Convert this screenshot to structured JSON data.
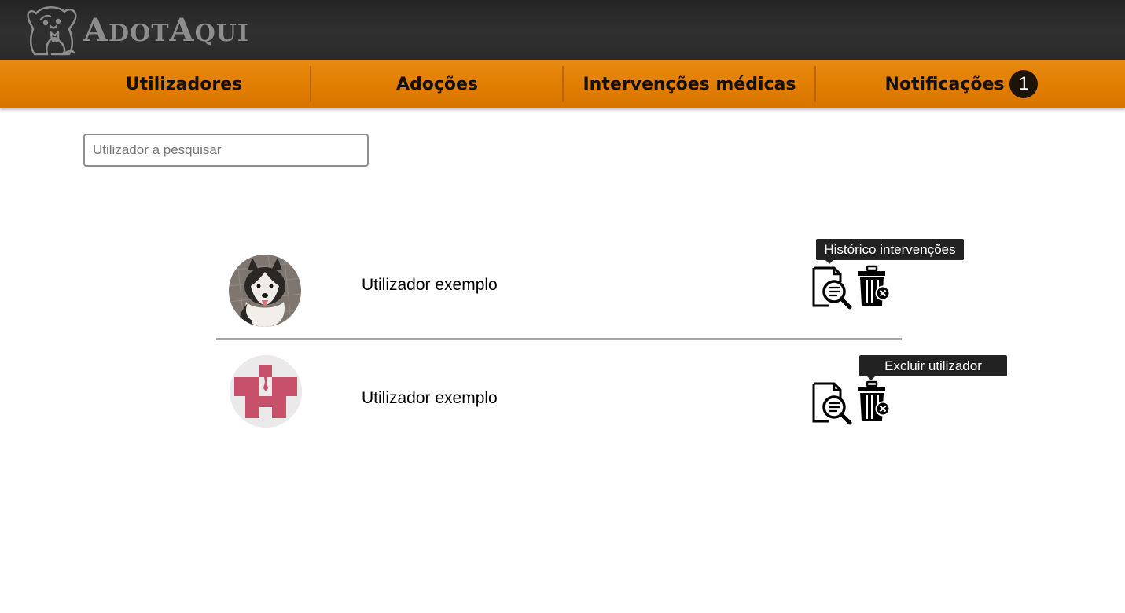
{
  "brand": {
    "name_first": "A",
    "name_first_rest": "DOT",
    "name_second": "A",
    "name_second_rest": "QUI"
  },
  "nav": {
    "items": [
      {
        "label": "Utilizadores"
      },
      {
        "label": "Adoções"
      },
      {
        "label": "Intervenções médicas"
      },
      {
        "label": "Notificações"
      }
    ],
    "notification_count": "1"
  },
  "search": {
    "placeholder": "Utilizador a pesquisar",
    "value": ""
  },
  "users": [
    {
      "name": "Utilizador exemplo",
      "avatar": "husky-dog-photo"
    },
    {
      "name": "Utilizador exemplo",
      "avatar": "default-user-avatar"
    }
  ],
  "tooltips": {
    "history": "Histórico intervenções",
    "delete": "Excluir utilizador"
  },
  "colors": {
    "header": "#2a2a2a",
    "navbar": "#e07d00",
    "badge": "#1e1309",
    "logo": "#8d8d8d"
  }
}
